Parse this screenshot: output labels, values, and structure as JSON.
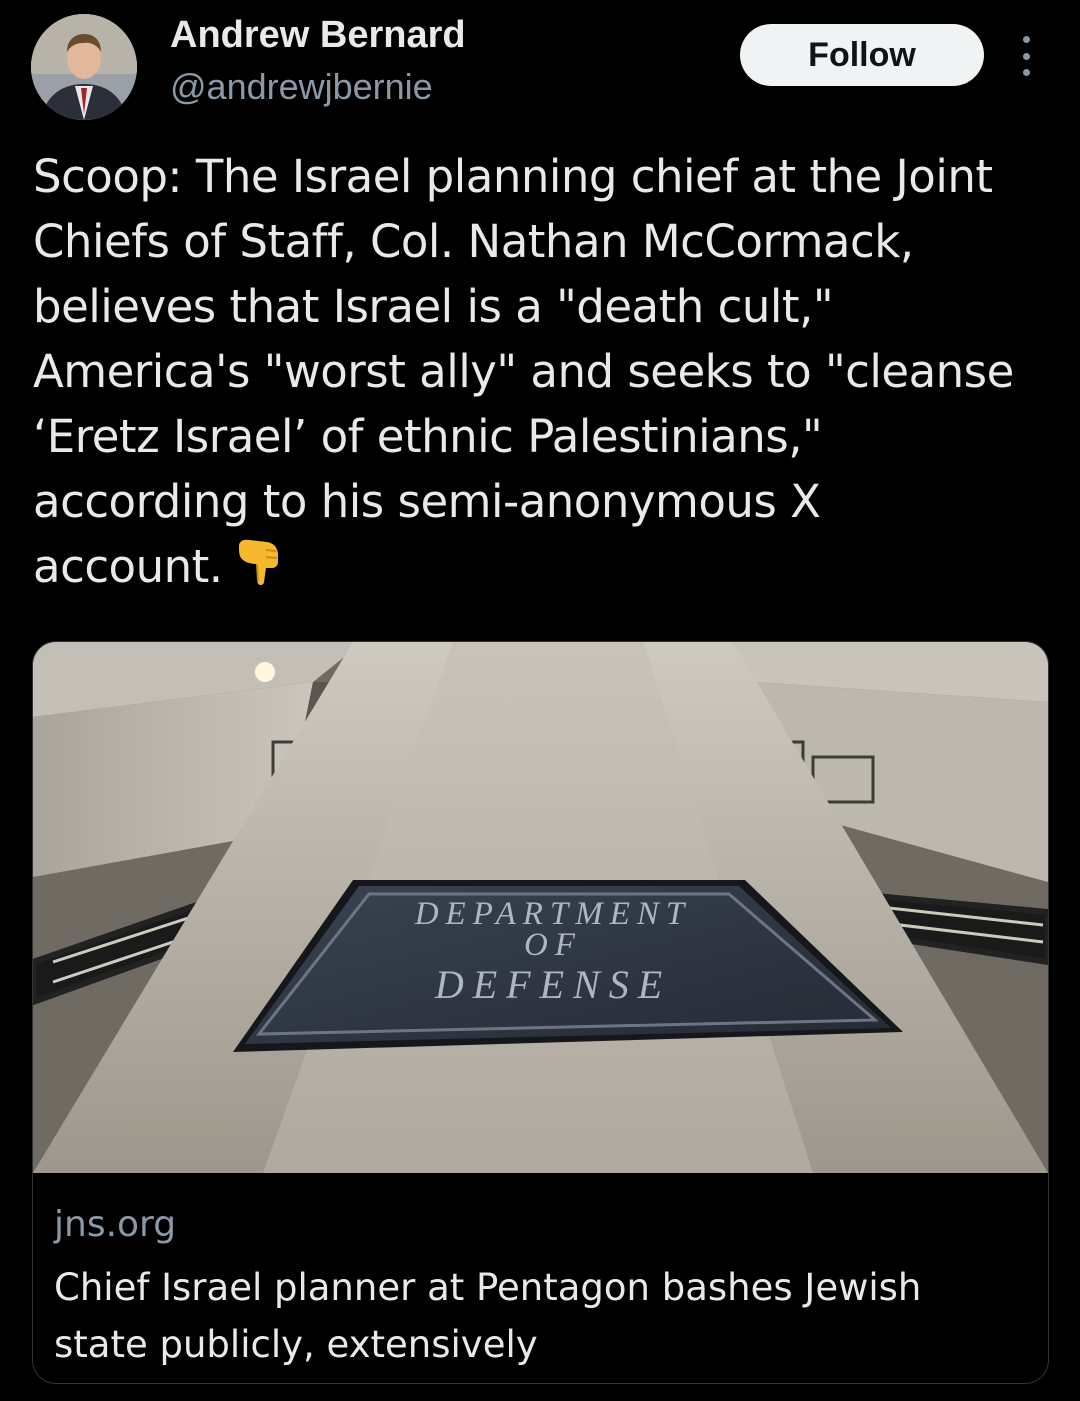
{
  "author": {
    "display_name": "Andrew Bernard",
    "handle": "@andrewjbernie"
  },
  "follow_label": "Follow",
  "more_icon": "more-vertical-icon",
  "tweet": {
    "lines": [
      "Scoop: The Israel planning chief at the Joint",
      "Chiefs of Staff, Col. Nathan McCormack,",
      "believes that Israel is a \"death cult,\"",
      "America's \"worst ally\" and seeks to \"cleanse",
      "‘Eretz Israel’ of ethnic Palestinians,\"",
      "according to his semi-anonymous X",
      "account."
    ],
    "emoji": "pointing-down-hand-icon"
  },
  "link_card": {
    "sign_text": [
      "DEPARTMENT",
      "OF",
      "DEFENSE"
    ],
    "domain": "jns.org",
    "title": "Chief Israel planner at Pentagon bashes Jewish state publicly, extensively"
  },
  "colors": {
    "background": "#000000",
    "text": "#e7e9ea",
    "secondary_text": "#8b98a5",
    "follow_button_bg": "#eff3f4",
    "card_border": "#2f3336",
    "emoji": "#f5b82e"
  }
}
